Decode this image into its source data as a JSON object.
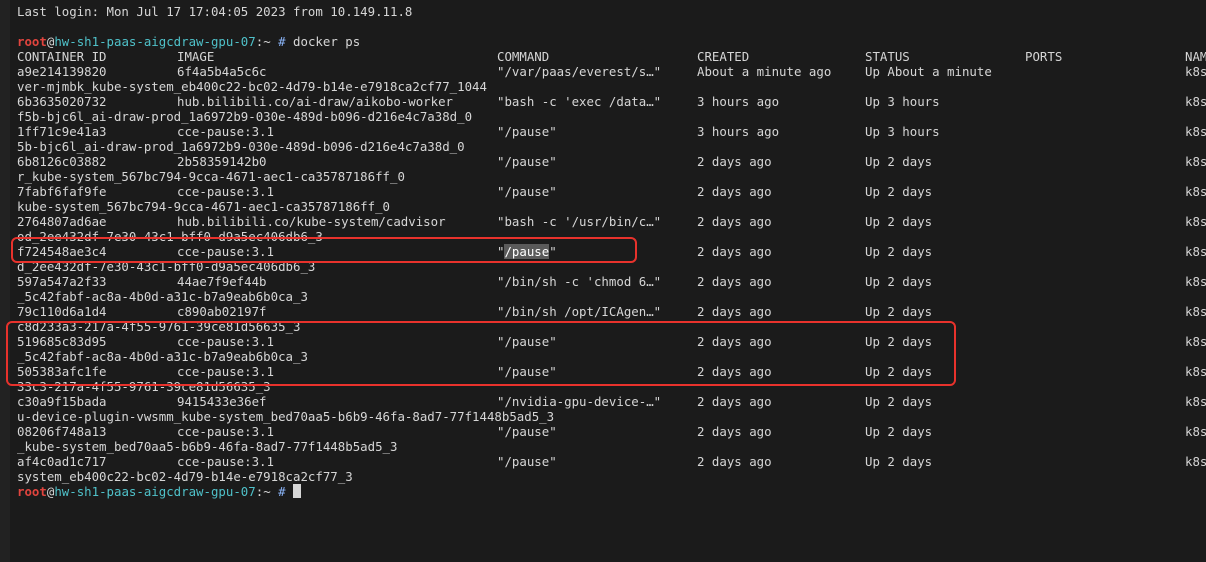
{
  "window": {
    "background": "#1b1b1b",
    "prompt_color_user": "#e0443e",
    "prompt_color_host": "#4fc1c9",
    "annotation_color": "#e8322c"
  },
  "last_login": "Last login: Mon Jul 17 17:04:05 2023 from 10.149.11.8",
  "prompt": {
    "user": "root",
    "at": "@",
    "host": "hw-sh1-paas-aigcdraw-gpu-07",
    "path": ":~ ",
    "hash": "#",
    "command": " docker ps"
  },
  "headers": {
    "container_id": "CONTAINER ID",
    "image": "IMAGE",
    "command": "COMMAND",
    "created": "CREATED",
    "status": "STATUS",
    "ports": "PORTS",
    "names": "NAM"
  },
  "rows": [
    {
      "container_id": "a9e214139820",
      "image": "6f4a5b4a5c6c",
      "command": "\"/var/paas/everest/s…\"",
      "created": "About a minute ago",
      "status": "Up About a minute",
      "names": "k8s",
      "wrap": "ver-mjmbk_kube-system_eb400c22-bc02-4d79-b14e-e7918ca2cf77_1044"
    },
    {
      "container_id": "6b3635020732",
      "image": "hub.bilibili.co/ai-draw/aikobo-worker",
      "command": "\"bash -c 'exec /data…\"",
      "created": "3 hours ago",
      "status": "Up 3 hours",
      "names": "k8s",
      "wrap": "f5b-bjc6l_ai-draw-prod_1a6972b9-030e-489d-b096-d216e4c7a38d_0"
    },
    {
      "container_id": "1ff71c9e41a3",
      "image": "cce-pause:3.1",
      "command": "\"/pause\"",
      "created": "3 hours ago",
      "status": "Up 3 hours",
      "names": "k8s",
      "wrap": "5b-bjc6l_ai-draw-prod_1a6972b9-030e-489d-b096-d216e4c7a38d_0"
    },
    {
      "container_id": "6b8126c03882",
      "image": "2b58359142b0",
      "command": "\"/pause\"",
      "created": "2 days ago",
      "status": "Up 2 days",
      "names": "k8s",
      "wrap": "r_kube-system_567bc794-9cca-4671-aec1-ca35787186ff_0"
    },
    {
      "container_id": "7fabf6faf9fe",
      "image": "cce-pause:3.1",
      "command": "\"/pause\"",
      "created": "2 days ago",
      "status": "Up 2 days",
      "names": "k8s",
      "wrap": "kube-system_567bc794-9cca-4671-aec1-ca35787186ff_0"
    },
    {
      "container_id": "2764807ad6ae",
      "image": "hub.bilibili.co/kube-system/cadvisor",
      "command": "\"bash -c '/usr/bin/c…\"",
      "created": "2 days ago",
      "status": "Up 2 days",
      "names": "k8s",
      "wrap": "od_2ee432df-7e30-43c1-bff0-d9a5ec406db6_3"
    },
    {
      "container_id": "f724548ae3c4",
      "image": "cce-pause:3.1",
      "command_prefix": "\"",
      "command_selected": "/pause",
      "command_suffix": "\"",
      "created": "2 days ago",
      "status": "Up 2 days",
      "names": "k8s",
      "wrap": "d_2ee432df-7e30-43c1-bff0-d9a5ec406db6_3"
    },
    {
      "container_id": "597a547a2f33",
      "image": "44ae7f9ef44b",
      "command": "\"/bin/sh -c 'chmod 6…\"",
      "created": "2 days ago",
      "status": "Up 2 days",
      "names": "k8s",
      "wrap": "_5c42fabf-ac8a-4b0d-a31c-b7a9eab6b0ca_3"
    },
    {
      "container_id": "79c110d6a1d4",
      "image": "c890ab02197f",
      "command": "\"/bin/sh /opt/ICAgen…\"",
      "created": "2 days ago",
      "status": "Up 2 days",
      "names": "k8s",
      "wrap": "c8d233a3-217a-4f55-9761-39ce81d56635_3"
    },
    {
      "container_id": "519685c83d95",
      "image": "cce-pause:3.1",
      "command": "\"/pause\"",
      "created": "2 days ago",
      "status": "Up 2 days",
      "names": "k8s",
      "wrap": "_5c42fabf-ac8a-4b0d-a31c-b7a9eab6b0ca_3"
    },
    {
      "container_id": "505383afc1fe",
      "image": "cce-pause:3.1",
      "command": "\"/pause\"",
      "created": "2 days ago",
      "status": "Up 2 days",
      "names": "k8s",
      "wrap": "33c3-217a-4f55-9761-39ce81d56635_3"
    },
    {
      "container_id": "c30a9f15bada",
      "image": "9415433e36ef",
      "command": "\"/nvidia-gpu-device-…\"",
      "created": "2 days ago",
      "status": "Up 2 days",
      "names": "k8s",
      "wrap": "u-device-plugin-vwsmm_kube-system_bed70aa5-b6b9-46fa-8ad7-77f1448b5ad5_3"
    },
    {
      "container_id": "08206f748a13",
      "image": "cce-pause:3.1",
      "command": "\"/pause\"",
      "created": "2 days ago",
      "status": "Up 2 days",
      "names": "k8s",
      "wrap": "_kube-system_bed70aa5-b6b9-46fa-8ad7-77f1448b5ad5_3"
    },
    {
      "container_id": "af4c0ad1c717",
      "image": "cce-pause:3.1",
      "command": "\"/pause\"",
      "created": "2 days ago",
      "status": "Up 2 days",
      "names": "k8s",
      "wrap": "system_eb400c22-bc02-4d79-b14e-e7918ca2cf77_3"
    }
  ]
}
